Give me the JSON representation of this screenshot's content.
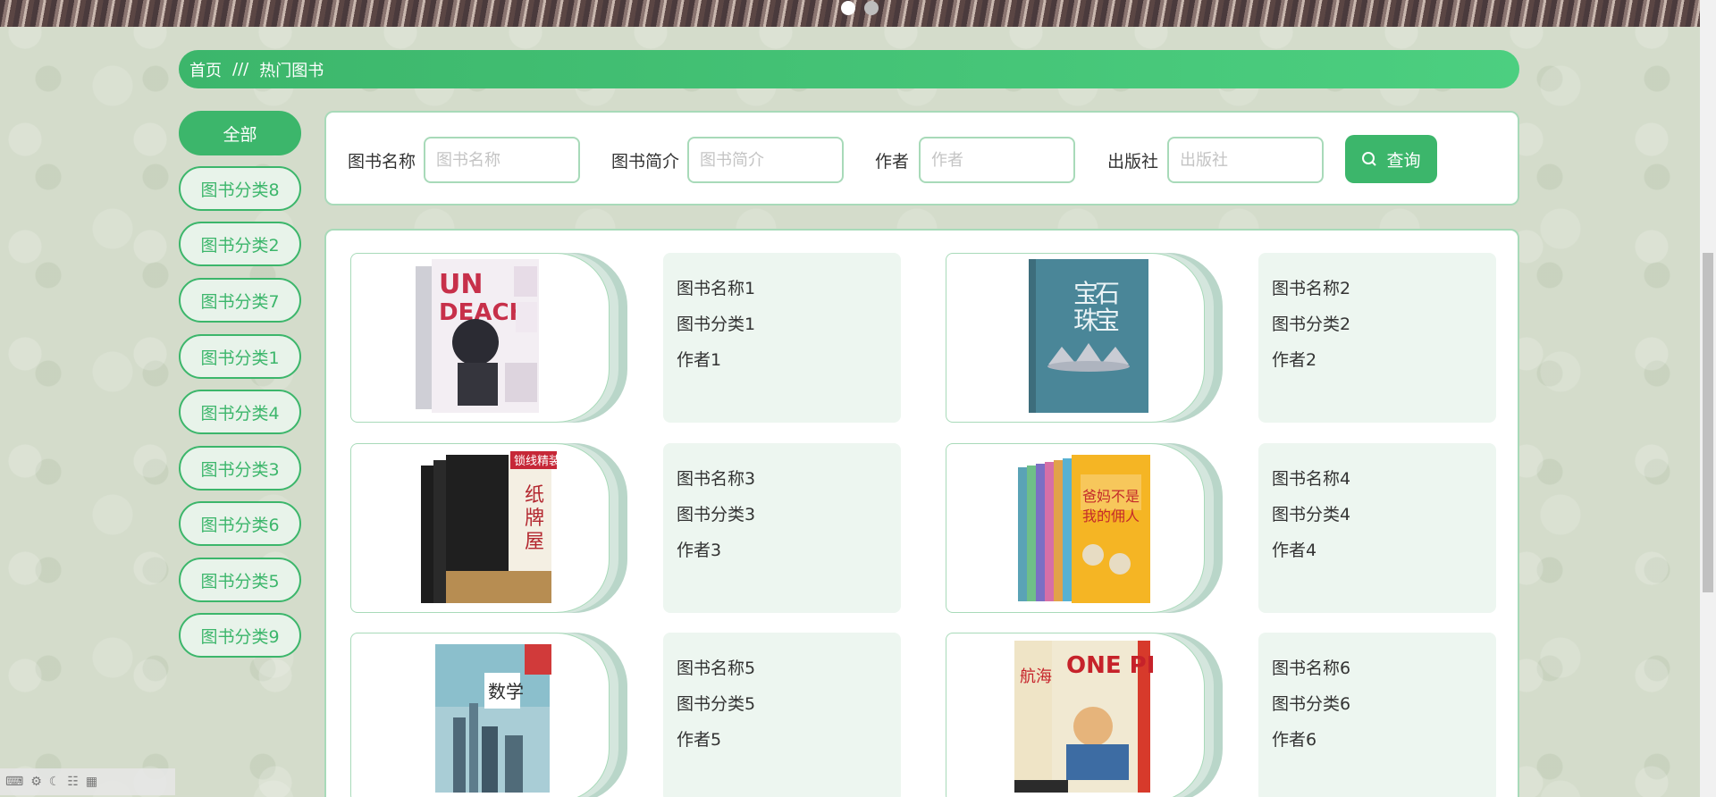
{
  "breadcrumb": {
    "home": "首页",
    "separator": "///",
    "current": "热门图书"
  },
  "categories": [
    {
      "label": "全部",
      "active": true
    },
    {
      "label": "图书分类8"
    },
    {
      "label": "图书分类2"
    },
    {
      "label": "图书分类7"
    },
    {
      "label": "图书分类1"
    },
    {
      "label": "图书分类4"
    },
    {
      "label": "图书分类3"
    },
    {
      "label": "图书分类6"
    },
    {
      "label": "图书分类5"
    },
    {
      "label": "图书分类9"
    }
  ],
  "search": {
    "name_label": "图书名称",
    "name_placeholder": "图书名称",
    "intro_label": "图书简介",
    "intro_placeholder": "图书简介",
    "author_label": "作者",
    "author_placeholder": "作者",
    "publisher_label": "出版社",
    "publisher_placeholder": "出版社",
    "query_label": "查询",
    "query_icon": "search-icon"
  },
  "books": [
    {
      "name": "图书名称1",
      "category": "图书分类1",
      "author": "作者1"
    },
    {
      "name": "图书名称2",
      "category": "图书分类2",
      "author": "作者2"
    },
    {
      "name": "图书名称3",
      "category": "图书分类3",
      "author": "作者3"
    },
    {
      "name": "图书名称4",
      "category": "图书分类4",
      "author": "作者4"
    },
    {
      "name": "图书名称5",
      "category": "图书分类5",
      "author": "作者5"
    },
    {
      "name": "图书名称6",
      "category": "图书分类6",
      "author": "作者6"
    }
  ],
  "colors": {
    "accent": "#3cb66b",
    "panel_border": "#a8dab9",
    "info_bg": "#edf6f0",
    "page_bg": "#d4dccb"
  }
}
